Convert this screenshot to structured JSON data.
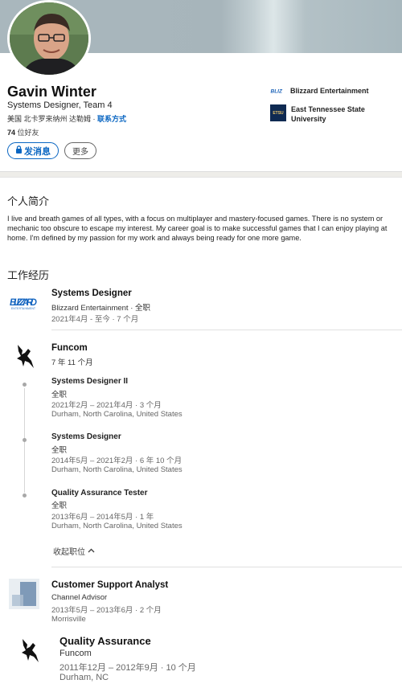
{
  "profile": {
    "name": "Gavin Winter",
    "headline": "Systems Designer, Team 4",
    "location": "美国 北卡罗来纳州 达勒姆 · ",
    "contact_link": "联系方式",
    "friends_count": "74",
    "friends_label": " 位好友"
  },
  "actions": {
    "message_label": "发消息",
    "more_label": "更多"
  },
  "companies": [
    {
      "name": "Blizzard Entertainment",
      "logo_icon": "blizzard-logo"
    },
    {
      "name": "East Tennessee State University",
      "name_line1": "East Tennessee State",
      "name_line2": "University",
      "logo_icon": "etsu-logo",
      "logo_text": "ETSU"
    }
  ],
  "about": {
    "title": "个人简介",
    "text": "I live and breath games of all types, with a focus on multiplayer and mastery-focused games. There is no system or mechanic too obscure to escape my interest. My career goal is to make successful games that I can enjoy playing at home. I'm defined by my passion for my work and always being ready for one more game."
  },
  "experience": {
    "title": "工作经历",
    "blizzard": {
      "title": "Systems Designer",
      "company": "Blizzard Entertainment · 全职",
      "dates": "2021年4月 - 至今 · 7 个月"
    },
    "funcom": {
      "company": "Funcom",
      "duration": "7 年 11 个月",
      "roles": [
        {
          "title": "Systems Designer II",
          "type": "全职",
          "dates": "2021年2月 – 2021年4月 · 3 个月",
          "location": "Durham, North Carolina, United States"
        },
        {
          "title": "Systems Designer",
          "type": "全职",
          "dates": "2014年5月 – 2021年2月 · 6 年 10 个月",
          "location": "Durham, North Carolina, United States"
        },
        {
          "title": "Quality Assurance Tester",
          "type": "全职",
          "dates": "2013年6月 – 2014年5月 · 1 年",
          "location": "Durham, North Carolina, United States"
        }
      ],
      "collapse_label": "收起职位"
    },
    "channel": {
      "title": "Customer Support Analyst",
      "company": "Channel Advisor",
      "dates": "2013年5月 – 2013年6月 · 2 个月",
      "location": "Morrisville"
    },
    "funcom_qa": {
      "title": "Quality Assurance",
      "company": "Funcom",
      "dates": "2011年12月 – 2012年9月 · 10 个月",
      "location": "Durham, NC"
    }
  },
  "colors": {
    "accent": "#0a66c2",
    "banner": "#a9b7bd"
  }
}
